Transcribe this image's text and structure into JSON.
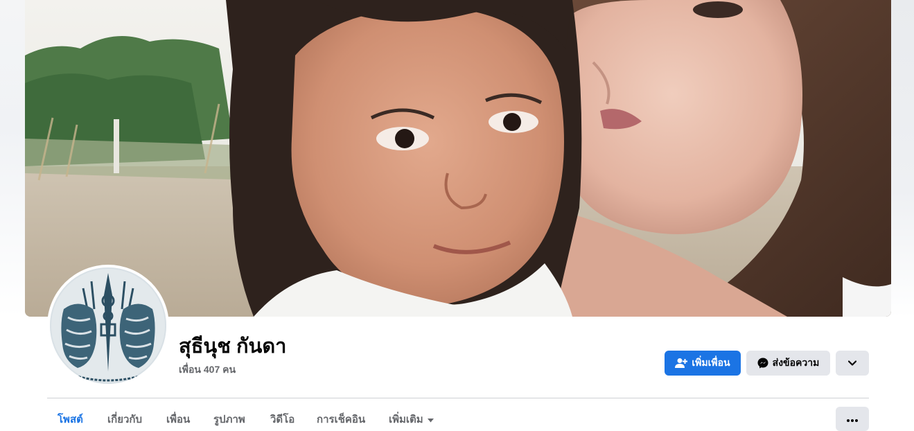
{
  "profile": {
    "name": "สุธีนุช กันดา",
    "friends_text": "เพื่อน 407 คน"
  },
  "actions": {
    "add_friend_label": "เพิ่มเพื่อน",
    "message_label": "ส่งข้อความ"
  },
  "tabs": [
    {
      "label": "โพสต์",
      "active": true
    },
    {
      "label": "เกี่ยวกับ",
      "active": false
    },
    {
      "label": "เพื่อน",
      "active": false
    },
    {
      "label": "รูปภาพ",
      "active": false
    },
    {
      "label": "วิดีโอ",
      "active": false
    },
    {
      "label": "การเช็คอิน",
      "active": false
    },
    {
      "label": "เพิ่มเติม",
      "active": false
    }
  ],
  "icons": {
    "add_friend": "person-plus-icon",
    "message": "messenger-icon",
    "more": "chevron-down-icon",
    "tab_more": "caret-down-icon",
    "options": "ellipsis-icon"
  },
  "colors": {
    "accent": "#1b74e4",
    "secondary_button": "#e4e6eb",
    "muted_text": "#65676b"
  }
}
